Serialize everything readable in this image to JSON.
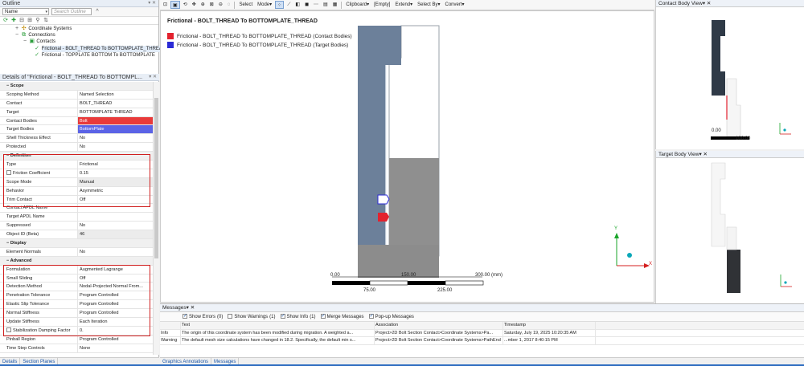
{
  "outline": {
    "title": "Outline",
    "name_combo": "Name",
    "search_placeholder": "Search Outline",
    "tree": [
      {
        "label": "Coordinate Systems",
        "level": 1
      },
      {
        "label": "Connections",
        "level": 1
      },
      {
        "label": "Contacts",
        "level": 2
      },
      {
        "label": "Frictional - BOLT_THREAD To BOTTOMPLATE_THREAD",
        "level": 3
      },
      {
        "label": "Frictional - TOPPLATE BOTTOM To BOTTOMPLATE",
        "level": 3
      }
    ]
  },
  "details": {
    "title": "Details of \"Frictional - BOLT_THREAD To BOTTOMPL...",
    "rows": [
      {
        "type": "cat",
        "k": "Scope"
      },
      {
        "k": "Scoping Method",
        "v": "Named Selection"
      },
      {
        "k": "Contact",
        "v": "BOLT_THREAD"
      },
      {
        "k": "Target",
        "v": "BOTTOMPLATE THREAD"
      },
      {
        "k": "Contact Bodies",
        "v": "Bolt",
        "style": "red"
      },
      {
        "k": "Target Bodies",
        "v": "BottomPlate",
        "style": "blue"
      },
      {
        "k": "Shell Thickness Effect",
        "v": "No"
      },
      {
        "k": "Protected",
        "v": "No"
      },
      {
        "type": "cat",
        "k": "Definition"
      },
      {
        "k": "Type",
        "v": "Frictional"
      },
      {
        "k": "Friction Coefficient",
        "v": "0.15",
        "check": true
      },
      {
        "k": "Scope Mode",
        "v": "Manual",
        "style": "gray"
      },
      {
        "k": "Behavior",
        "v": "Asymmetric"
      },
      {
        "k": "Trim Contact",
        "v": "Off"
      },
      {
        "k": "Contact APDL Name",
        "v": ""
      },
      {
        "k": "Target APDL Name",
        "v": ""
      },
      {
        "k": "Suppressed",
        "v": "No"
      },
      {
        "k": "Object ID (Beta)",
        "v": "46",
        "style": "gray"
      },
      {
        "type": "cat",
        "k": "Display"
      },
      {
        "k": "Element Normals",
        "v": "No"
      },
      {
        "type": "cat",
        "k": "Advanced"
      },
      {
        "k": "Formulation",
        "v": "Augmented Lagrange"
      },
      {
        "k": "Small Sliding",
        "v": "Off"
      },
      {
        "k": "Detection Method",
        "v": "Nodal-Projected Normal From..."
      },
      {
        "k": "Penetration Tolerance",
        "v": "Program Controlled"
      },
      {
        "k": "Elastic Slip Tolerance",
        "v": "Program Controlled"
      },
      {
        "k": "Normal Stiffness",
        "v": "Program Controlled"
      },
      {
        "k": "Update Stiffness",
        "v": "Each Iteration"
      },
      {
        "k": "Stabilization Damping Factor",
        "v": "0.",
        "check": true
      },
      {
        "k": "Pinball Region",
        "v": "Program Controlled"
      },
      {
        "k": "Time Step Controls",
        "v": "None"
      }
    ]
  },
  "left_tabs": [
    "Details",
    "Section Planes"
  ],
  "toolbar": {
    "items": [
      "Select",
      "Mode",
      "Clipboard",
      "[Empty]",
      "Extend",
      "Select By",
      "Convert"
    ]
  },
  "graphics": {
    "title": "Frictional - BOLT_THREAD To BOTTOMPLATE_THREAD",
    "legend": [
      {
        "label": "Frictional - BOLT_THREAD To BOTTOMPLATE_THREAD (Contact Bodies)",
        "color": "#e3222e"
      },
      {
        "label": "Frictional - BOLT_THREAD To BOTTOMPLATE_THREAD (Target Bodies)",
        "color": "#2a2ad6"
      }
    ],
    "scale_top": [
      "0.00",
      "150.00",
      "300.00 (mm)"
    ],
    "scale_bottom": [
      "75.00",
      "225.00"
    ],
    "axis_x": "X",
    "axis_y": "Y"
  },
  "contact_view": {
    "title": "Contact Body View",
    "scale": [
      "0.00",
      "100.00"
    ]
  },
  "target_view": {
    "title": "Target Body View"
  },
  "messages": {
    "title": "Messages",
    "filters": [
      {
        "label": "Show Errors",
        "count": "(0)",
        "on": true
      },
      {
        "label": "Show Warnings",
        "count": "(1)",
        "on": false
      },
      {
        "label": "Show Info",
        "count": "(1)",
        "on": true
      },
      {
        "label": "Merge Messages",
        "count": "",
        "on": true
      },
      {
        "label": "Pop-up Messages",
        "count": "",
        "on": true
      }
    ],
    "headers": [
      "",
      "Text",
      "Association",
      "Timestamp"
    ],
    "rows": [
      {
        "c0": "Info",
        "c1": "The origin of this coordinate system has been modified during migration. A weighted a...",
        "c2": "Project>2D Bolt Section Contact>Coordinate Systems>Pa...",
        "c3": "Saturday, July 19, 2025 10:20:35 AM"
      },
      {
        "c0": "Warning",
        "c1": "The default mesh size calculations have changed in 18.2. Specifically, the default min s...",
        "c2": "Project>2D Bolt Section Contact>Coordinate Systems>PathEnd",
        "c3": "...mber 1, 2017 8:40:15 PM"
      }
    ]
  },
  "bottom_tabs": [
    "Graphics Annotations",
    "Messages"
  ]
}
